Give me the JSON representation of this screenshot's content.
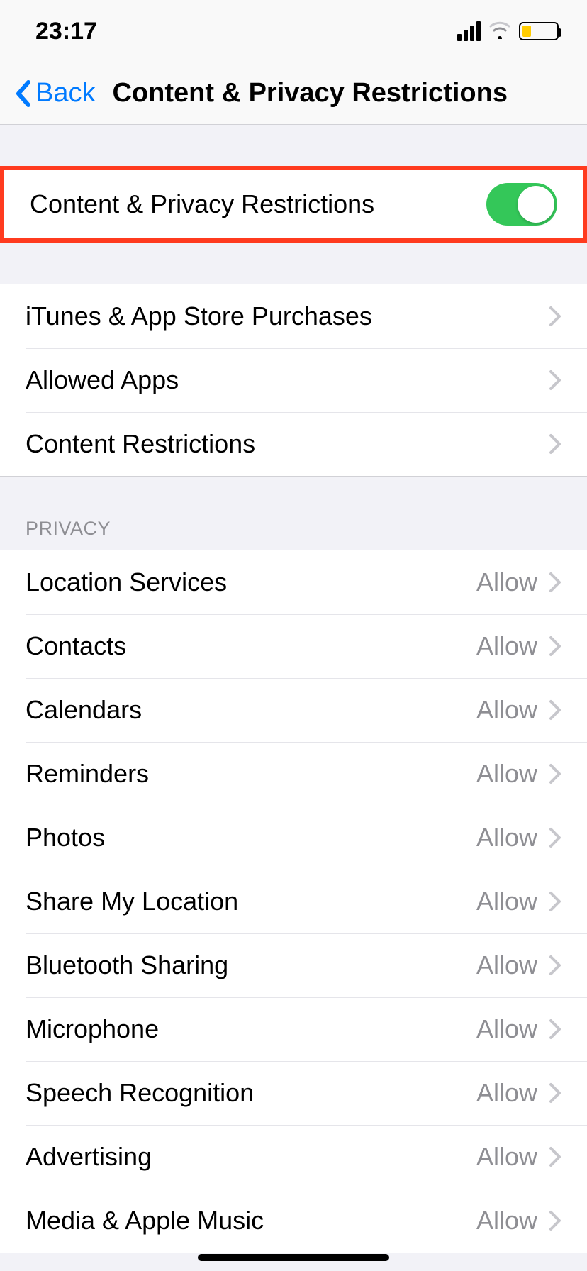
{
  "status": {
    "time": "23:17"
  },
  "nav": {
    "back": "Back",
    "title": "Content & Privacy Restrictions"
  },
  "toggle": {
    "label": "Content & Privacy Restrictions",
    "on": true
  },
  "section1": {
    "items": [
      {
        "label": "iTunes & App Store Purchases"
      },
      {
        "label": "Allowed Apps"
      },
      {
        "label": "Content Restrictions"
      }
    ]
  },
  "privacy": {
    "header": "Privacy",
    "items": [
      {
        "label": "Location Services",
        "value": "Allow"
      },
      {
        "label": "Contacts",
        "value": "Allow"
      },
      {
        "label": "Calendars",
        "value": "Allow"
      },
      {
        "label": "Reminders",
        "value": "Allow"
      },
      {
        "label": "Photos",
        "value": "Allow"
      },
      {
        "label": "Share My Location",
        "value": "Allow"
      },
      {
        "label": "Bluetooth Sharing",
        "value": "Allow"
      },
      {
        "label": "Microphone",
        "value": "Allow"
      },
      {
        "label": "Speech Recognition",
        "value": "Allow"
      },
      {
        "label": "Advertising",
        "value": "Allow"
      },
      {
        "label": "Media & Apple Music",
        "value": "Allow"
      }
    ]
  }
}
